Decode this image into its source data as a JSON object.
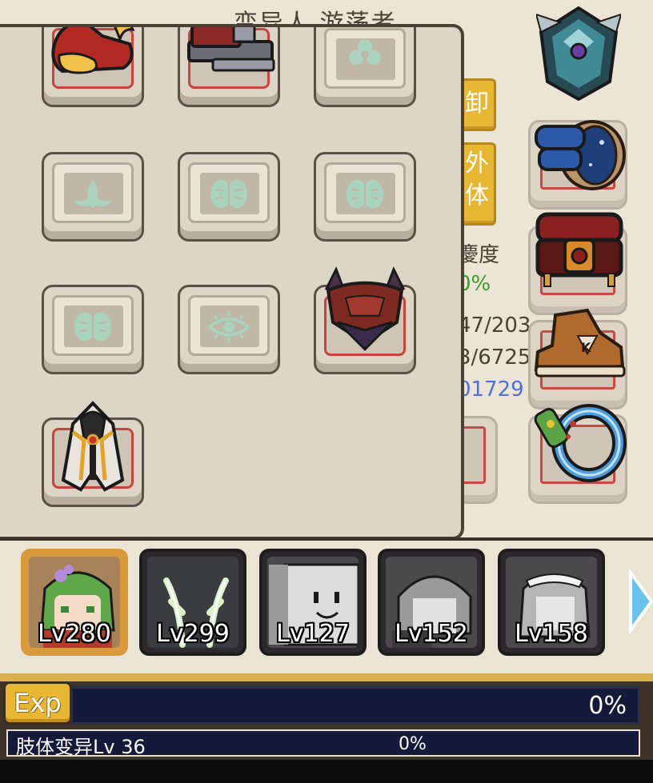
{
  "header": {
    "character_title": "变异人 游荡者"
  },
  "side_buttons": {
    "unequip_label": "卸",
    "external_body_label": "外体"
  },
  "stats": {
    "label": "度",
    "percent": "0%",
    "value_1": "47/203",
    "value_2": "3/6725",
    "value_3": "01729"
  },
  "equipment_slots": [
    {
      "icon": "crest-emblem-icon"
    },
    {
      "icon": "bracer-icon"
    },
    {
      "icon": "belt-icon"
    },
    {
      "icon": "sneaker-icon"
    },
    {
      "icon": "ring-icon"
    }
  ],
  "inventory": {
    "slots": [
      {
        "id": "slot-1",
        "icon": "red-fox-boots-icon",
        "equipped": true
      },
      {
        "id": "slot-2",
        "icon": "mech-gauntlet-icon",
        "equipped": true
      },
      {
        "id": "slot-3",
        "icon": "organ-glyph-icon",
        "equipped": false
      },
      {
        "id": "slot-4",
        "icon": "tentacle-glyph-icon",
        "equipped": false
      },
      {
        "id": "slot-5",
        "icon": "brain-glyph-icon",
        "equipped": false
      },
      {
        "id": "slot-6",
        "icon": "brain-glyph-icon",
        "equipped": false
      },
      {
        "id": "slot-7",
        "icon": "brain-glyph-icon",
        "equipped": false
      },
      {
        "id": "slot-8",
        "icon": "eye-glyph-icon",
        "equipped": false
      },
      {
        "id": "slot-9",
        "icon": "demon-chest-armor-icon",
        "equipped": true
      },
      {
        "id": "slot-10",
        "icon": "hooded-cloak-icon",
        "equipped": true
      }
    ]
  },
  "characters": [
    {
      "level": "Lv280",
      "active": true,
      "portrait": "green-haired-girl"
    },
    {
      "level": "Lv299",
      "active": false,
      "portrait": "antlers"
    },
    {
      "level": "Lv127",
      "active": false,
      "portrait": "box-head"
    },
    {
      "level": "Lv152",
      "active": false,
      "portrait": "grey-hair-boy"
    },
    {
      "level": "Lv158",
      "active": false,
      "portrait": "maid"
    }
  ],
  "exp": {
    "button_label": "Exp",
    "percent": "0%",
    "limb_label": "肢体变异Lv 36",
    "limb_percent": "0%"
  },
  "colors": {
    "panel_bg": "#ddd5c6",
    "accent_gold": "#e7b733",
    "equipped_border": "#c9443e",
    "exp_bar": "#141b3a",
    "stat_green": "#3b9b2f",
    "stat_blue": "#4f6fd6"
  }
}
